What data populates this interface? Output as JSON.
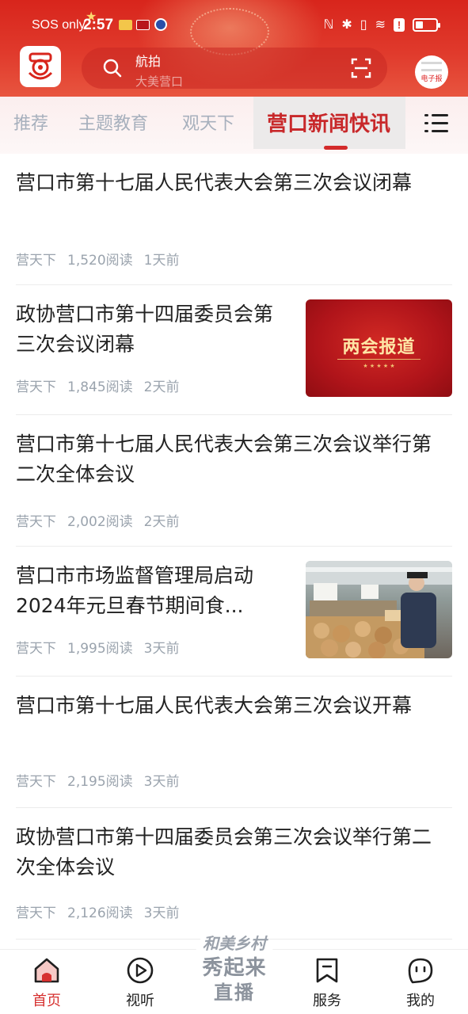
{
  "status_bar": {
    "carrier": "SOS only",
    "time": "2:57"
  },
  "header": {
    "search_hint_top": "航拍",
    "search_hint_bottom": "大美营口",
    "epaper_label": "电子报"
  },
  "tabs": [
    {
      "label": "推荐"
    },
    {
      "label": "主题教育"
    },
    {
      "label": "观天下"
    },
    {
      "label": "营口新闻快讯"
    }
  ],
  "active_tab_index": 3,
  "news": [
    {
      "title": "营口市第十七届人民代表大会第三次会议闭幕",
      "source": "营天下",
      "reads": "1,520阅读",
      "time": "1天前"
    },
    {
      "title": "政协营口市第十四届委员会第三次会议闭幕",
      "source": "营天下",
      "reads": "1,845阅读",
      "time": "2天前",
      "thumb_caption": "两会报道"
    },
    {
      "title": "营口市第十七届人民代表大会第三次会议举行第二次全体会议",
      "source": "营天下",
      "reads": "2,002阅读",
      "time": "2天前"
    },
    {
      "title": "营口市市场监督管理局启动2024年元旦春节期间食...",
      "source": "营天下",
      "reads": "1,995阅读",
      "time": "3天前"
    },
    {
      "title": "营口市第十七届人民代表大会第三次会议开幕",
      "source": "营天下",
      "reads": "2,195阅读",
      "time": "3天前"
    },
    {
      "title": "政协营口市第十四届委员会第三次会议举行第二次全体会议",
      "source": "营天下",
      "reads": "2,126阅读",
      "time": "3天前"
    }
  ],
  "bottom_nav": {
    "home": "首页",
    "media": "视听",
    "live_line1": "和美乡村",
    "live_line2": "秀起来",
    "live_line3": "直播",
    "services": "服务",
    "mine": "我的"
  },
  "colors": {
    "brand_red": "#d8251c",
    "active_tab": "#c8282a",
    "meta_gray": "#9aa3ad"
  }
}
